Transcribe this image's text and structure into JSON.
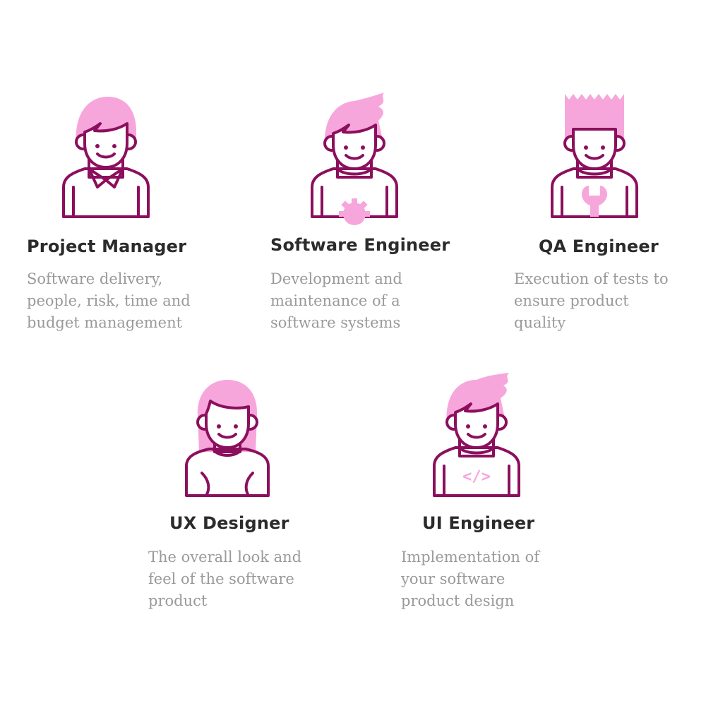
{
  "colors": {
    "accent_outline": "#8c0f5d",
    "accent_fill": "#f7a6dc",
    "title_text": "#2b2b2b",
    "desc_text": "#9a9a9a"
  },
  "roles": [
    {
      "title": "Project Manager",
      "description": "Software delivery,\npeople, risk, time and\nbudget management",
      "icon": "project-manager-avatar-icon"
    },
    {
      "title": "Software Engineer",
      "description": "Development and\nmaintenance of a\nsoftware systems",
      "icon": "software-engineer-avatar-icon"
    },
    {
      "title": "QA Engineer",
      "description": "Execution of tests to\nensure product\nquality",
      "icon": "qa-engineer-avatar-icon"
    },
    {
      "title": "UX Designer",
      "description": "The overall look and\nfeel of the software\nproduct",
      "icon": "ux-designer-avatar-icon"
    },
    {
      "title": "UI Engineer",
      "description": "Implementation of\nyour software\nproduct design",
      "icon": "ui-engineer-avatar-icon",
      "shirt_glyph": "</>"
    }
  ]
}
